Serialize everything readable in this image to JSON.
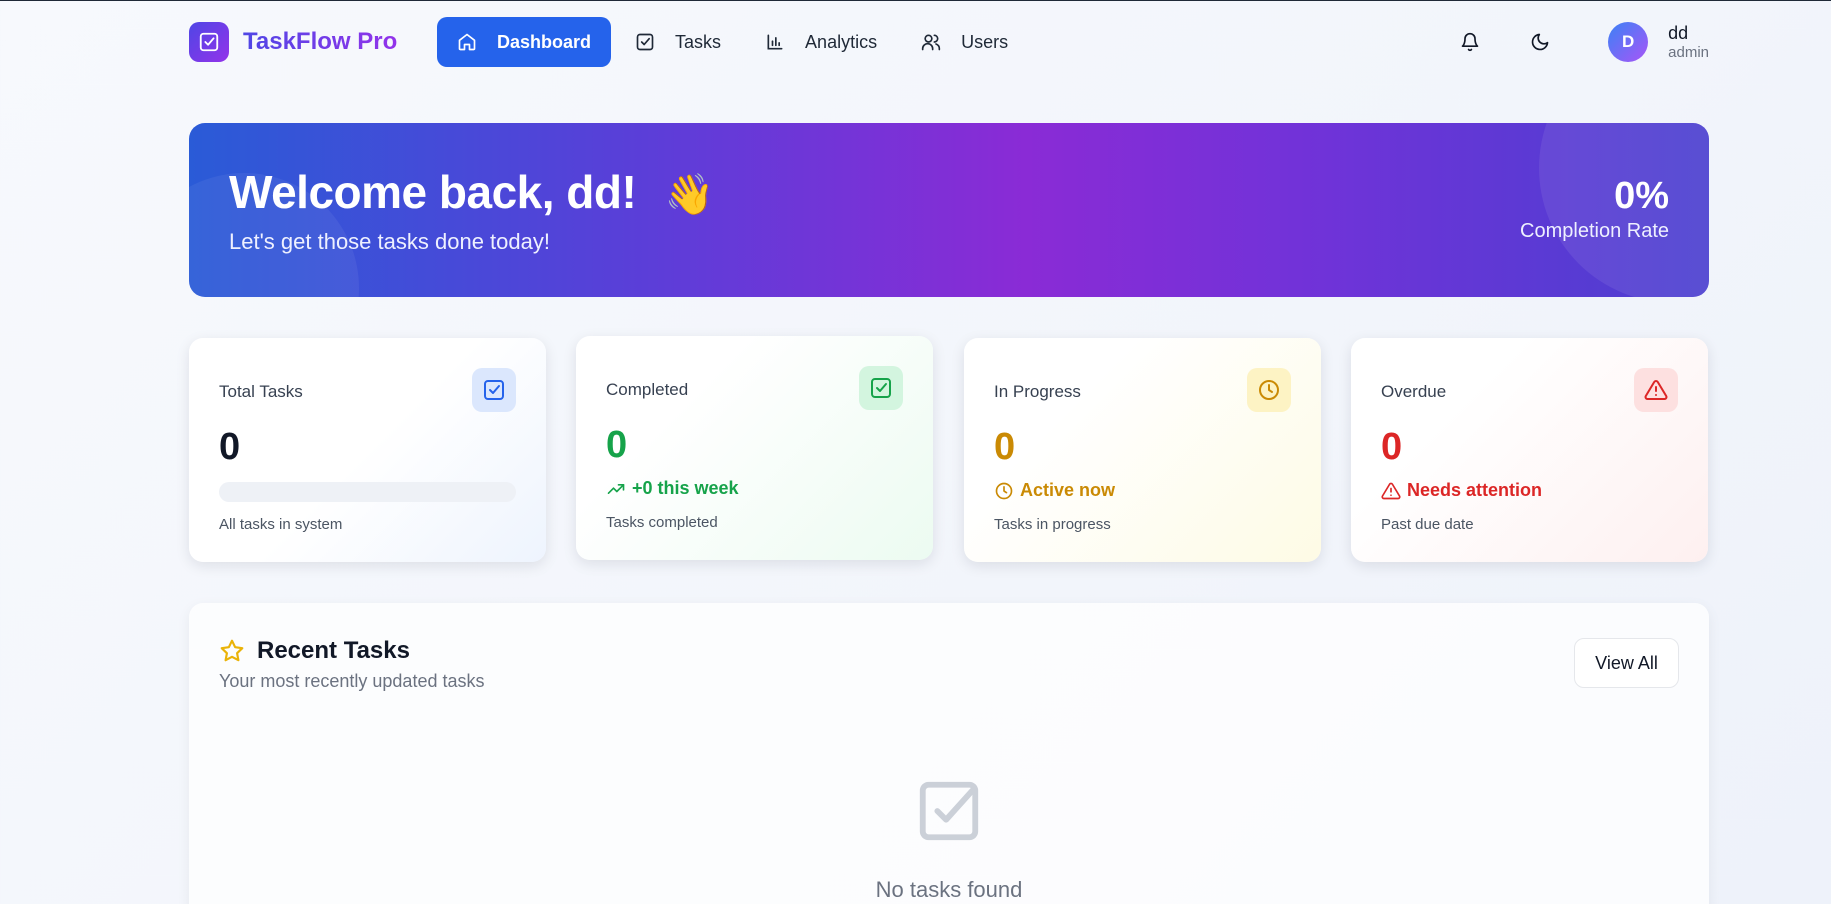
{
  "app": {
    "name": "TaskFlow Pro"
  },
  "nav": {
    "items": [
      {
        "label": "Dashboard",
        "icon": "home-icon",
        "active": true
      },
      {
        "label": "Tasks",
        "icon": "checkbox-icon",
        "active": false
      },
      {
        "label": "Analytics",
        "icon": "bar-chart-icon",
        "active": false
      },
      {
        "label": "Users",
        "icon": "users-icon",
        "active": false
      }
    ]
  },
  "user": {
    "initial": "D",
    "name": "dd",
    "role": "admin"
  },
  "hero": {
    "title": "Welcome back, dd!",
    "emoji": "👋",
    "subtitle": "Let's get those tasks done today!",
    "completion_value": "0%",
    "completion_label": "Completion Rate"
  },
  "stats": {
    "total": {
      "label": "Total Tasks",
      "value": "0",
      "desc": "All tasks in system",
      "progress": 0
    },
    "completed": {
      "label": "Completed",
      "value": "0",
      "trend": "+0 this week",
      "desc": "Tasks completed"
    },
    "in_progress": {
      "label": "In Progress",
      "value": "0",
      "trend": "Active now",
      "desc": "Tasks in progress"
    },
    "overdue": {
      "label": "Overdue",
      "value": "0",
      "trend": "Needs attention",
      "desc": "Past due date"
    }
  },
  "recent": {
    "title": "Recent Tasks",
    "subtitle": "Your most recently updated tasks",
    "view_all": "View All",
    "empty_text": "No tasks found"
  },
  "colors": {
    "primary": "#2563eb",
    "brand_start": "#4f46e5",
    "brand_end": "#9333ea",
    "success": "#16a34a",
    "warning": "#ca8a04",
    "danger": "#dc2626"
  }
}
